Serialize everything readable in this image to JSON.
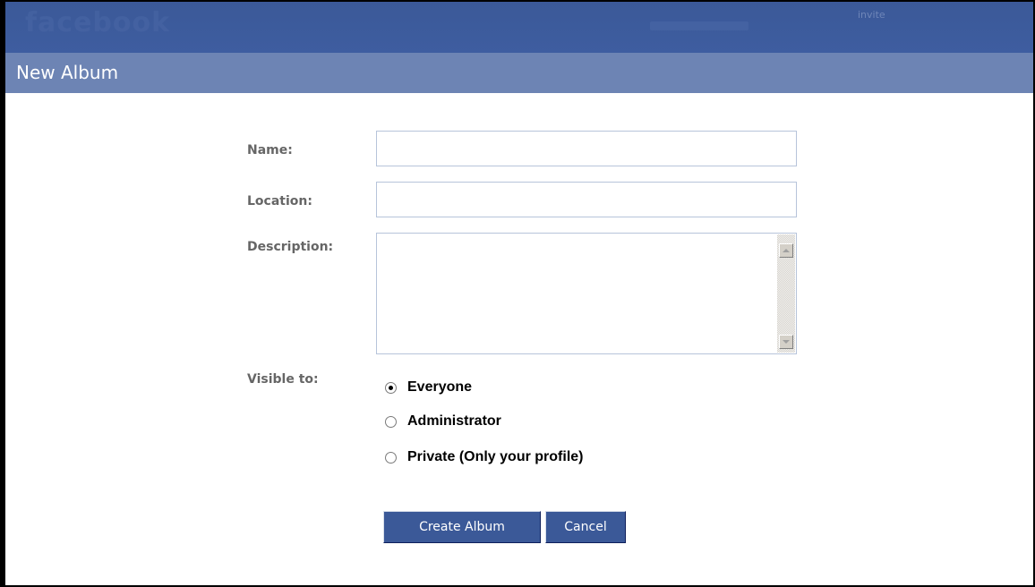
{
  "header": {
    "logo": "facebook",
    "invite_label": "invite"
  },
  "page": {
    "title": "New Album"
  },
  "form": {
    "name_label": "Name:",
    "name_value": "",
    "location_label": "Location:",
    "location_value": "",
    "description_label": "Description:",
    "description_value": "",
    "visible_label": "Visible to:",
    "visibility_options": [
      {
        "label": "Everyone",
        "selected": true
      },
      {
        "label": "Administrator",
        "selected": false
      },
      {
        "label": "Private (Only your profile)",
        "selected": false
      }
    ],
    "create_button": "Create Album",
    "cancel_button": "Cancel"
  },
  "colors": {
    "topbar": "#3b5998",
    "titlebar": "#6d84b4",
    "button": "#3b5998"
  }
}
